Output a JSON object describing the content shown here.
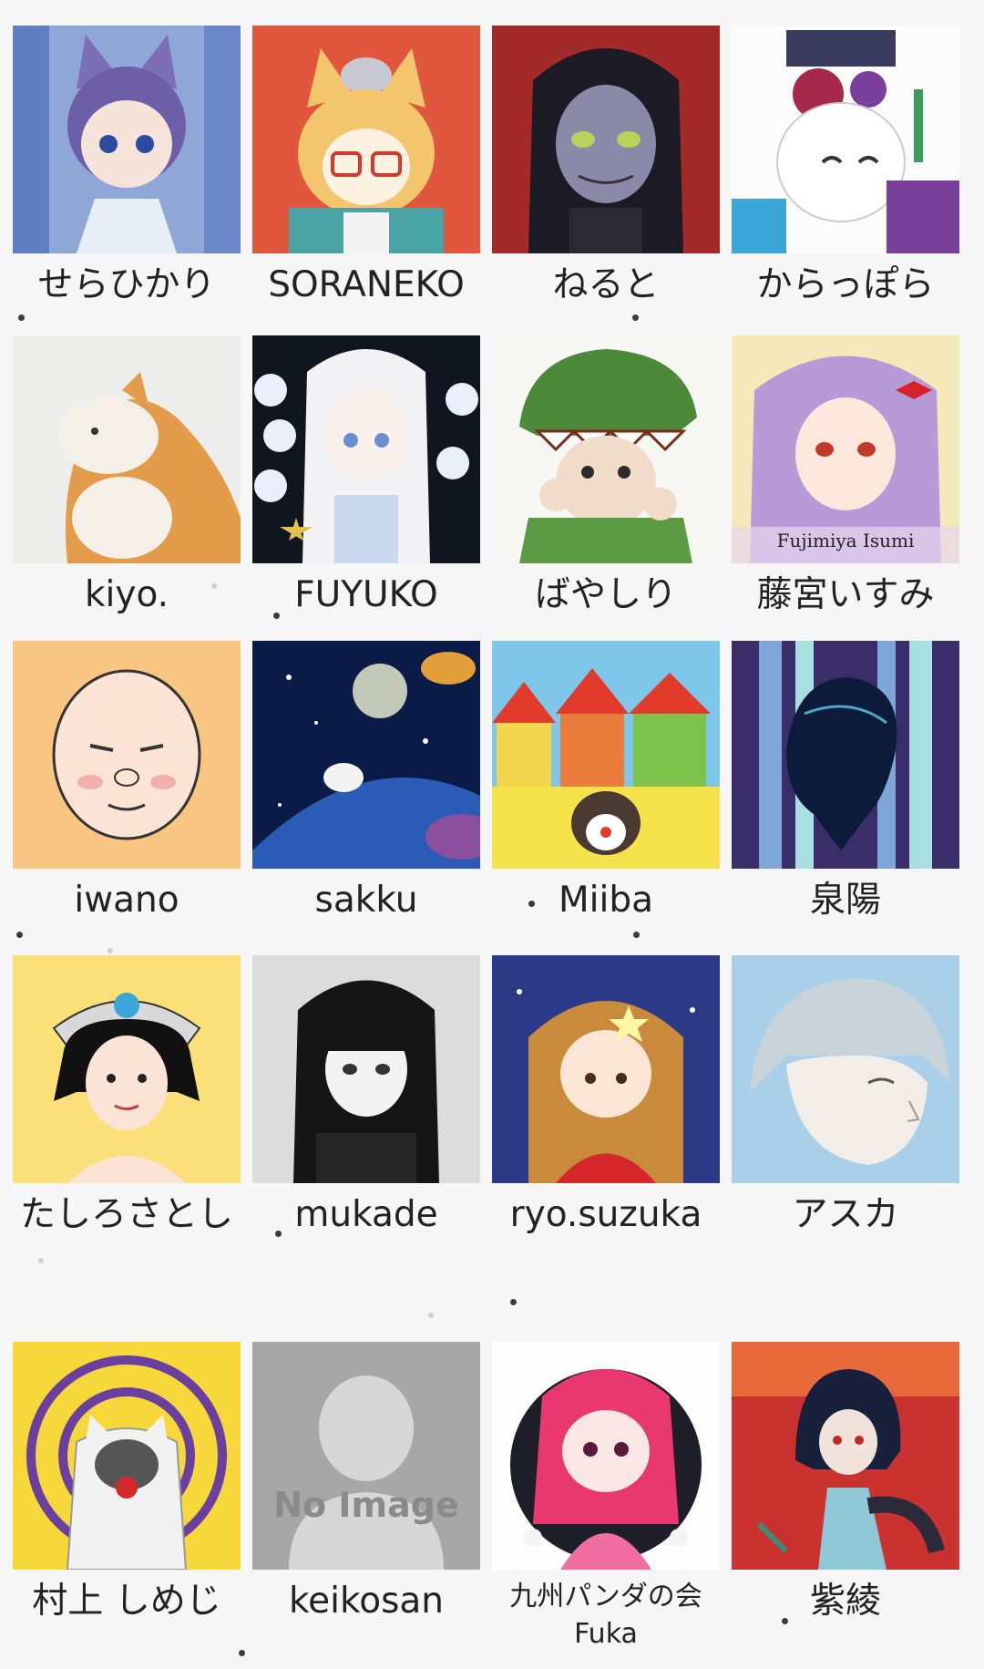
{
  "artists": [
    {
      "name": "せらひかり"
    },
    {
      "name": "SORANEKO"
    },
    {
      "name": "ねると"
    },
    {
      "name": "からっぽら"
    },
    {
      "name": "kiyo."
    },
    {
      "name": "FUYUKO"
    },
    {
      "name": "ばやしり"
    },
    {
      "name": "藤宮いすみ",
      "avatar_signature": "Fujimiya Isumi"
    },
    {
      "name": "iwano"
    },
    {
      "name": "sakku"
    },
    {
      "name": "Miiba"
    },
    {
      "name": "泉陽"
    },
    {
      "name": "たしろさとし"
    },
    {
      "name": "mukade"
    },
    {
      "name": "ryo.suzuka"
    },
    {
      "name": "アスカ"
    },
    {
      "name": "村上 しめじ"
    },
    {
      "name": "keikosan",
      "placeholder_text": "No Image"
    },
    {
      "name_line1": "九州パンダの会",
      "name_line2": "Fuka"
    },
    {
      "name": "紫綾"
    }
  ]
}
